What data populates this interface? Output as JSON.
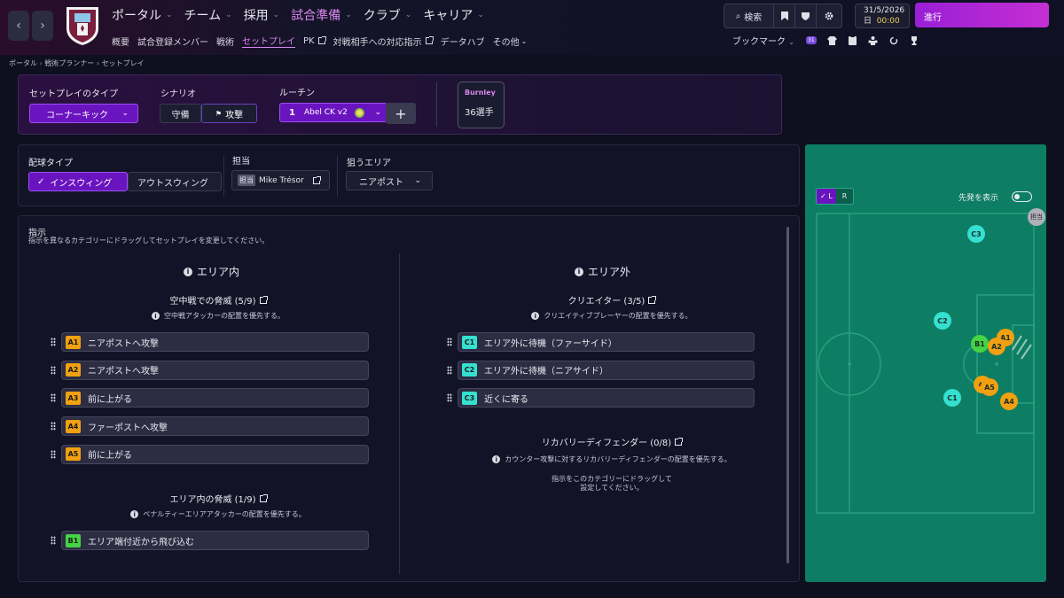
{
  "topbar": {
    "nav": [
      {
        "label": "ポータル",
        "active": false
      },
      {
        "label": "チーム",
        "active": false
      },
      {
        "label": "採用",
        "active": false
      },
      {
        "label": "試合準備",
        "active": true
      },
      {
        "label": "クラブ",
        "active": false
      },
      {
        "label": "キャリア",
        "active": false
      }
    ],
    "subnav": [
      {
        "label": "概要",
        "active": false,
        "ext": false
      },
      {
        "label": "試合登録メンバー",
        "active": false,
        "ext": false
      },
      {
        "label": "戦術",
        "active": false,
        "ext": false
      },
      {
        "label": "セットプレイ",
        "active": true,
        "ext": false
      },
      {
        "label": "PK",
        "active": false,
        "ext": true
      },
      {
        "label": "対戦相手への対応指示",
        "active": false,
        "ext": true
      },
      {
        "label": "データハブ",
        "active": false,
        "ext": false
      },
      {
        "label": "その他",
        "active": false,
        "ext": false
      }
    ],
    "search_label": "検索",
    "date": "31/5/2026",
    "day": "日",
    "time": "00:00",
    "proceed_label": "進行",
    "bookmark_label": "ブックマーク",
    "notification_count": "31"
  },
  "breadcrumb": [
    "ポータル",
    "戦術プランナー",
    "セットプレイ"
  ],
  "setpiece": {
    "type_label": "セットプレイのタイプ",
    "type_value": "コーナーキック",
    "scenario_label": "シナリオ",
    "scenario_defend": "守備",
    "scenario_attack": "攻撃",
    "routine_label": "ルーチン",
    "routine_number": "1",
    "routine_name": "Abel CK v2",
    "team_name": "Burnley",
    "team_count": "36選手"
  },
  "delivery": {
    "label": "配球タイプ",
    "inswing": "インスウィング",
    "outswing": "アウトスウィング",
    "taker_label": "担当",
    "taker_badge": "担当",
    "taker_name": "Mike Trésor",
    "target_label": "狙うエリア",
    "target_value": "ニアポスト"
  },
  "instructions": {
    "title": "指示",
    "subtitle": "指示を異なるカテゴリーにドラッグしてセットプレイを変更してください。",
    "inside": {
      "heading": "エリア内",
      "categories": [
        {
          "title": "空中戦での脅威 (5/9)",
          "desc": "空中戦アタッカーの配置を優先する。",
          "items": [
            {
              "code": "A1",
              "label": "ニアポストへ攻撃"
            },
            {
              "code": "A2",
              "label": "ニアポストへ攻撃"
            },
            {
              "code": "A3",
              "label": "前に上がる"
            },
            {
              "code": "A4",
              "label": "ファーポストへ攻撃"
            },
            {
              "code": "A5",
              "label": "前に上がる"
            }
          ]
        },
        {
          "title": "エリア内の脅威 (1/9)",
          "desc": "ペナルティーエリアアタッカーの配置を優先する。",
          "items": [
            {
              "code": "B1",
              "label": "エリア端付近から飛び込む"
            }
          ]
        }
      ]
    },
    "outside": {
      "heading": "エリア外",
      "categories": [
        {
          "title": "クリエイター (3/5)",
          "desc": "クリエイティブプレーヤーの配置を優先する。",
          "items": [
            {
              "code": "C1",
              "label": "エリア外に待機（ファーサイド）"
            },
            {
              "code": "C2",
              "label": "エリア外に待機（ニアサイド）"
            },
            {
              "code": "C3",
              "label": "近くに寄る"
            }
          ]
        },
        {
          "title": "リカバリーディフェンダー (0/8)",
          "desc": "カウンター攻撃に対するリカバリーディフェンダーの配置を優先する。",
          "empty": "指示をこのカテゴリーにドラッグして設定してください。",
          "items": []
        }
      ]
    }
  },
  "pitch": {
    "side_left": "L",
    "side_right": "R",
    "show_starters_label": "先発を表示",
    "taker_marker": "担当",
    "players": [
      {
        "code": "C3",
        "color": "#35e0d0"
      },
      {
        "code": "C2",
        "color": "#35e0d0"
      },
      {
        "code": "C1",
        "color": "#35e0d0"
      },
      {
        "code": "B1",
        "color": "#44d444"
      },
      {
        "code": "A1",
        "color": "#f0a010"
      },
      {
        "code": "A2",
        "color": "#f0a010"
      },
      {
        "code": "A3",
        "color": "#f0a010"
      },
      {
        "code": "A4",
        "color": "#f0a010"
      },
      {
        "code": "A5",
        "color": "#f0a010"
      }
    ]
  },
  "colors": {
    "accent": "#d787ee",
    "chip_a": "#f0a010",
    "chip_b": "#44d444",
    "chip_c": "#35e0d0",
    "pitch": "#0d7e63"
  }
}
